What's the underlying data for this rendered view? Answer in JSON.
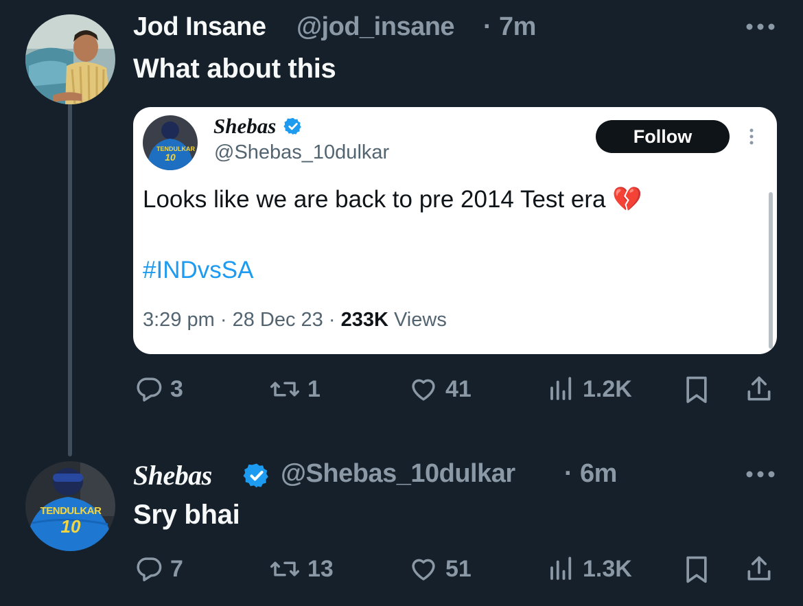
{
  "thread": {
    "first_tweet": {
      "display_name": "Jod Insane",
      "handle": "@jod_insane",
      "dot": "·",
      "time": "7m",
      "text": "What about this",
      "quote": {
        "display_name": "Shebas",
        "handle": "@Shebas_10dulkar",
        "follow_label": "Follow",
        "text": "Looks like we are back to pre 2014 Test era",
        "emoji": "💔",
        "hashtag": "#INDvsSA",
        "time": "3:29 pm",
        "date": "28 Dec 23",
        "sep": "·",
        "views_count": "233K",
        "views_label": "Views",
        "avatar_jersey_name": "TENDULKAR",
        "avatar_jersey_number": "10"
      },
      "actions": {
        "replies": "3",
        "reposts": "1",
        "likes": "41",
        "views": "1.2K"
      }
    },
    "second_tweet": {
      "display_name": "Shebas",
      "handle": "@Shebas_10dulkar",
      "dot": "·",
      "time": "6m",
      "text": "Sry bhai",
      "avatar_jersey_name": "TENDULKAR",
      "avatar_jersey_number": "10",
      "actions": {
        "replies": "7",
        "reposts": "13",
        "likes": "51",
        "views": "1.3K"
      }
    }
  },
  "icons": {
    "more": "more-horizontal-icon",
    "verified": "verified-badge-icon",
    "reply": "reply-icon",
    "repost": "repost-icon",
    "like": "heart-icon",
    "views": "analytics-icon",
    "bookmark": "bookmark-icon",
    "share": "share-icon"
  },
  "colors": {
    "background": "#15202b",
    "text_primary": "#f7f9f9",
    "text_secondary": "#8b98a5",
    "verified": "#1d9bf0",
    "hashtag": "#1d9bf0",
    "thread_line": "#3f4e5c"
  }
}
